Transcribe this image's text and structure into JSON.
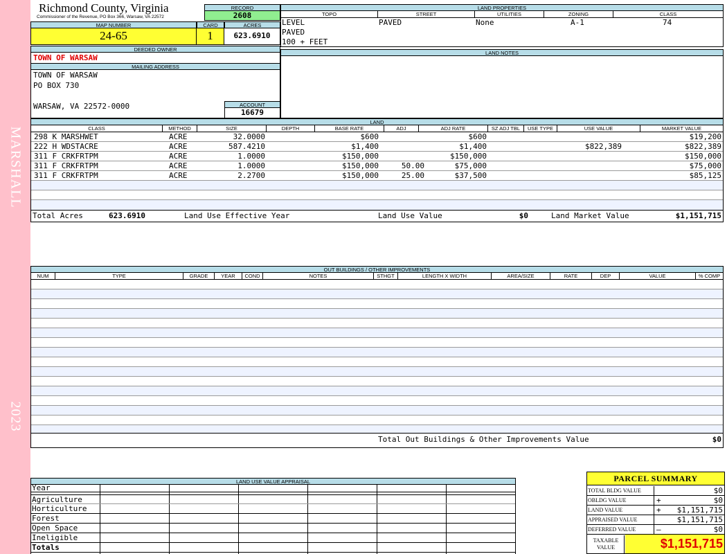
{
  "side": {
    "name": "MARSHALL",
    "year": "2023"
  },
  "header": {
    "county": "Richmond County, Virginia",
    "subtitle": "Commissioner of the Revenue, PO Box 366, Warsaw, VA 22572",
    "record_label": "RECORD",
    "record": "2608",
    "map_number_label": "MAP NUMBER",
    "map_number": "24-65",
    "card_label": "CARD",
    "card": "1",
    "acres_label": "ACRES",
    "acres": "623.6910"
  },
  "land_properties": {
    "title": "LAND PROPERTIES",
    "headers": [
      "TOPO",
      "STREET",
      "UTILITIES",
      "ZONING",
      "CLASS"
    ],
    "topo": [
      "LEVEL",
      "PAVED",
      "100 + FEET"
    ],
    "street": "PAVED",
    "utilities": "None",
    "zoning": "A-1",
    "class": "74"
  },
  "owner": {
    "deeded_label": "DEEDED OWNER",
    "deeded": "TOWN OF WARSAW",
    "mailing_label": "MAILING ADDRESS",
    "mailing": [
      "TOWN OF WARSAW",
      "PO BOX 730",
      "",
      "WARSAW, VA 22572-0000"
    ],
    "account_label": "ACCOUNT",
    "account": "16679"
  },
  "land_notes": {
    "title": "LAND NOTES"
  },
  "land": {
    "title": "LAND",
    "headers": [
      "CLASS",
      "METHOD",
      "SIZE",
      "DEPTH",
      "BASE RATE",
      "ADJ",
      "ADJ RATE",
      "SZ ADJ TBL",
      "USE TYPE",
      "USE VALUE",
      "MARKET VALUE"
    ],
    "rows": [
      [
        "298 K MARSHWET",
        "ACRE",
        "32.0000",
        "",
        "$600",
        "",
        "$600",
        "",
        "",
        "",
        "$19,200"
      ],
      [
        "222 H WDSTACRE",
        "ACRE",
        "587.4210",
        "",
        "$1,400",
        "",
        "$1,400",
        "",
        "",
        "$822,389",
        "$822,389"
      ],
      [
        "311 F CRKFRTPM",
        "ACRE",
        "1.0000",
        "",
        "$150,000",
        "",
        "$150,000",
        "",
        "",
        "",
        "$150,000"
      ],
      [
        "311 F CRKFRTPM",
        "ACRE",
        "1.0000",
        "",
        "$150,000",
        "50.00",
        "$75,000",
        "",
        "",
        "",
        "$75,000"
      ],
      [
        "311 F CRKFRTPM",
        "ACRE",
        "2.2700",
        "",
        "$150,000",
        "25.00",
        "$37,500",
        "",
        "",
        "",
        "$85,125"
      ]
    ],
    "total_acres_label": "Total Acres",
    "total_acres": "623.6910",
    "effective_year_label": "Land Use Effective Year",
    "use_value_label": "Land Use Value",
    "use_value": "$0",
    "market_value_label": "Land Market Value",
    "market_value": "$1,151,715"
  },
  "outbuildings": {
    "title": "OUT BUILDINGS / OTHER IMPROVEMENTS",
    "headers": [
      "NUM",
      "TYPE",
      "GRADE",
      "YEAR",
      "COND",
      "NOTES",
      "STHGT",
      "LENGTH X WIDTH",
      "AREA/SIZE",
      "RATE",
      "DEP",
      "VALUE",
      "% COMP"
    ],
    "total_label": "Total Out Buildings & Other Improvements Value",
    "total": "$0"
  },
  "land_use_appraisal": {
    "title": "LAND USE VALUE APPRAISAL",
    "rows": [
      "Year",
      "Agriculture",
      "Horticulture",
      "Forest",
      "Open Space",
      "Ineligible",
      "Totals"
    ]
  },
  "parcel_summary": {
    "title": "PARCEL SUMMARY",
    "rows": [
      {
        "label": "TOTAL BLDG VALUE",
        "sign": "",
        "value": "$0"
      },
      {
        "label": "OBLDG VALUE",
        "sign": "+",
        "value": "$0"
      },
      {
        "label": "LAND VALUE",
        "sign": "+",
        "value": "$1,151,715"
      },
      {
        "label": "APPRAISED VALUE",
        "sign": "",
        "value": "$1,151,715"
      },
      {
        "label": "DEFERRED VALUE",
        "sign": "–",
        "value": "$0"
      }
    ],
    "taxable_label": "TAXABLE VALUE",
    "taxable": "$1,151,715"
  },
  "colors": {
    "stripe": "#ffc0cb",
    "header_bg": "#b7dde8",
    "highlight": "#ffff33",
    "record_bg": "#90ee90",
    "red": "#e00000"
  }
}
